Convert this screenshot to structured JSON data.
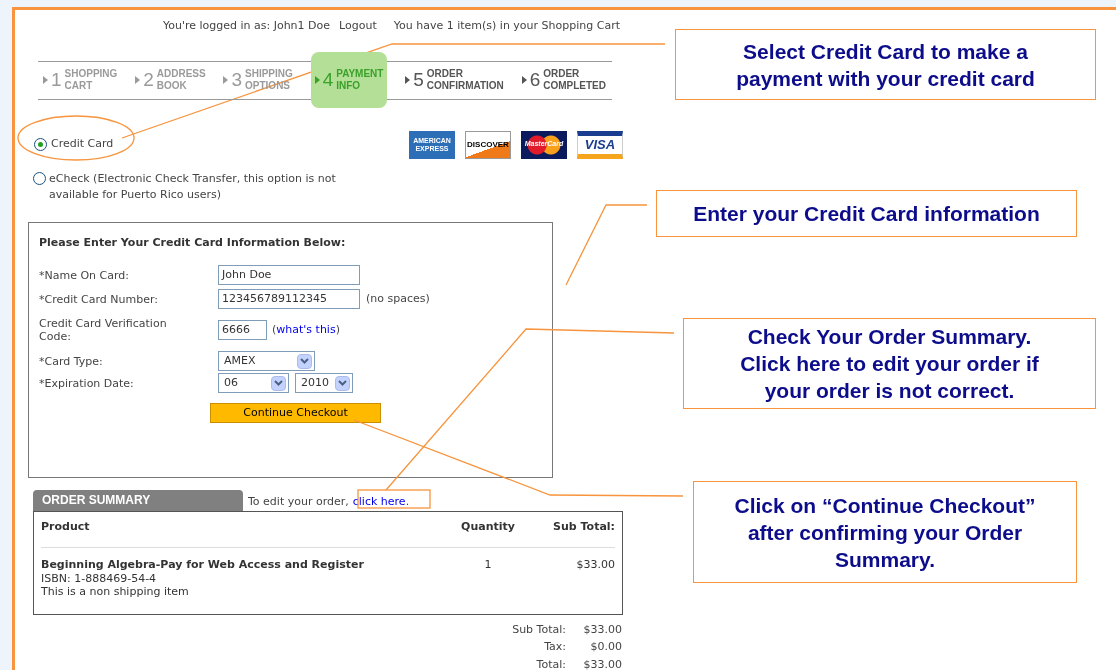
{
  "header": {
    "login_text": "You're logged in as: John1 Doe",
    "logout": "Logout",
    "cart_text": "You have 1 item(s) in your Shopping Cart"
  },
  "steps": [
    {
      "number": "1",
      "label": "SHOPPING CART",
      "selected": false,
      "done": true
    },
    {
      "number": "2",
      "label": "ADDRESS BOOK",
      "selected": false,
      "done": true
    },
    {
      "number": "3",
      "label": "SHIPPING OPTIONS",
      "selected": false,
      "done": true
    },
    {
      "number": "4",
      "label": "PAYMENT INFO",
      "selected": true,
      "done": false
    },
    {
      "number": "5",
      "label": "ORDER CONFIRMATION",
      "selected": false,
      "done": false
    },
    {
      "number": "6",
      "label": "ORDER COMPLETED",
      "selected": false,
      "done": false
    }
  ],
  "payment_options": [
    {
      "label": "Credit Card",
      "selected": true
    },
    {
      "label": "eCheck (Electronic Check Transfer, this option is not available for Puerto Rico users)",
      "selected": false
    }
  ],
  "card_logos": [
    {
      "kind": "amex",
      "label": "AMERICAN EXPRESS"
    },
    {
      "kind": "discover",
      "label": "DISCOVER"
    },
    {
      "kind": "mastercard",
      "label": "MasterCard"
    },
    {
      "kind": "visa",
      "label": "VISA"
    }
  ],
  "form": {
    "title": "Please Enter Your Credit Card Information Below:",
    "fields": [
      {
        "kind": "text",
        "label": "*Name On Card:",
        "value": "John Doe"
      },
      {
        "kind": "text",
        "label": "*Credit Card Number:",
        "value": "123456789112345",
        "note": "(no spaces)"
      },
      {
        "kind": "short",
        "label": "Credit Card Verification Code:",
        "value": "6666",
        "before": "(",
        "link": "what's this",
        "after": ")"
      },
      {
        "kind": "select",
        "label": "*Card Type:",
        "values": [
          "AMEX"
        ]
      },
      {
        "kind": "select",
        "label": "*Expiration Date:",
        "values": [
          "06",
          "2010"
        ]
      }
    ],
    "button": "Continue Checkout"
  },
  "order_summary": {
    "title": "ORDER SUMMARY",
    "edit_prefix": "To edit your order,",
    "edit_link": "click here",
    "edit_suffix": ".",
    "columns": [
      "Product",
      "Quantity",
      "Sub Total:"
    ],
    "rows": [
      {
        "product": "Beginning Algebra-Pay for Web Access and Register",
        "isbn": "ISBN: 1-888469-54-4",
        "note": "This is a non shipping item",
        "quantity": "1",
        "subtotal": "$33.00"
      }
    ],
    "totals": [
      {
        "label": "Sub Total:",
        "value": "$33.00"
      },
      {
        "label": "Tax:",
        "value": "$0.00"
      },
      {
        "label": "Total:",
        "value": "$33.00"
      }
    ]
  },
  "callouts": [
    "Select Credit Card to make a payment with your credit card",
    "Enter your Credit Card information",
    "Check Your Order Summary. Click here to edit your order if your order is not correct.",
    "Click on “Continue Checkout” after confirming your Order Summary."
  ]
}
